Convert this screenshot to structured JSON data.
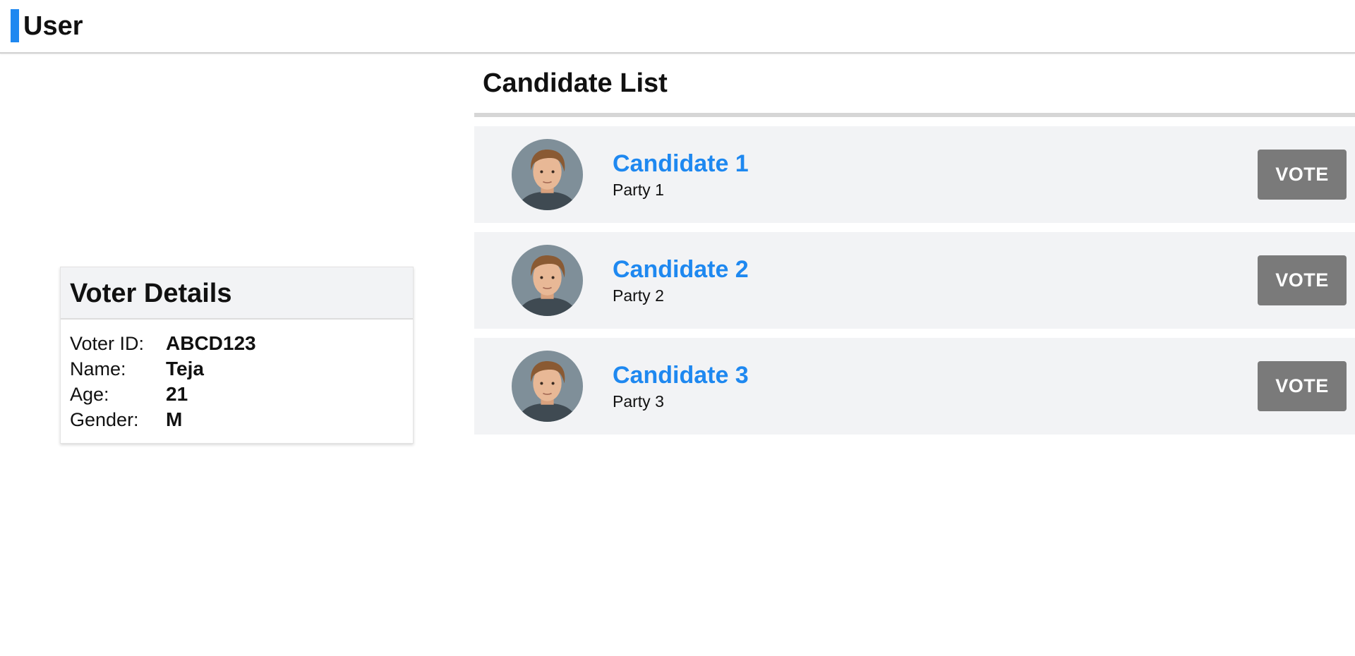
{
  "header": {
    "title": "User",
    "accent_color": "#1e88f0"
  },
  "candidates": {
    "title": "Candidate List",
    "name_color": "#1e88f0",
    "items": [
      {
        "name": "Candidate 1",
        "party": "Party 1",
        "vote_label": "VOTE",
        "avatar_icon": "person-avatar"
      },
      {
        "name": "Candidate 2",
        "party": "Party 2",
        "vote_label": "VOTE",
        "avatar_icon": "person-avatar"
      },
      {
        "name": "Candidate 3",
        "party": "Party 3",
        "vote_label": "VOTE",
        "avatar_icon": "person-avatar"
      }
    ]
  },
  "voter": {
    "title": "Voter Details",
    "fields": [
      {
        "label": "Voter ID:",
        "value": "ABCD123"
      },
      {
        "label": "Name:",
        "value": "Teja"
      },
      {
        "label": "Age:",
        "value": "21"
      },
      {
        "label": "Gender:",
        "value": "M"
      }
    ]
  }
}
